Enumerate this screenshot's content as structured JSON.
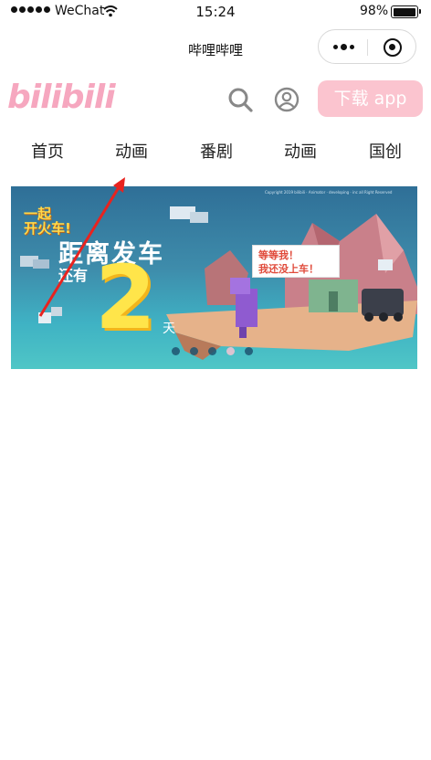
{
  "status_bar": {
    "carrier": "WeChat",
    "time": "15:24",
    "battery_percent": "98%",
    "battery_level": 0.98
  },
  "nav": {
    "title": "哔哩哔哩"
  },
  "header": {
    "logo_text": "bilibili",
    "download_label": "下载 app"
  },
  "tabs": [
    "首页",
    "动画",
    "番剧",
    "动画",
    "国创"
  ],
  "banner": {
    "corner_text_1": "一起",
    "corner_text_2": "开火车!",
    "main_text": "距离发车",
    "sub_text": "还有",
    "number": "2",
    "unit": "天",
    "speech_line_1": "等等我！",
    "speech_line_2": "我还没上车！",
    "copyright": "Copyright 2019 bilibili · Animator · developing · inc all Right Reserved",
    "slide_count": 5,
    "active_slide": 3
  },
  "colors": {
    "brand_pink": "#f6a7bf",
    "download_bg": "#fbc4cf",
    "annotation_red": "#e8231f"
  },
  "icons": {
    "search": "search-icon",
    "user": "user-icon",
    "more": "more-dots-icon",
    "close": "close-target-icon",
    "wifi": "wifi-icon",
    "battery": "battery-icon"
  }
}
